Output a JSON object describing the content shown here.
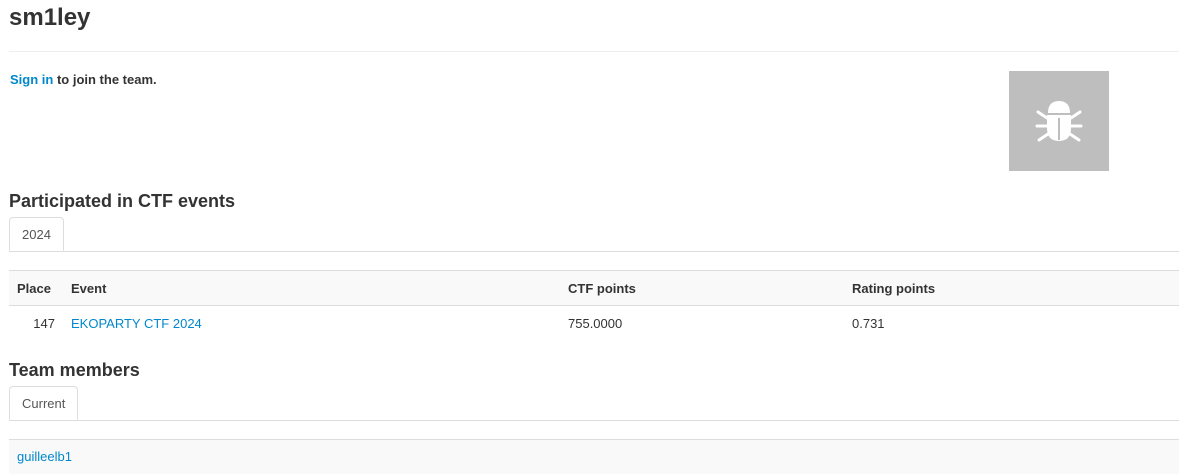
{
  "team": {
    "name": "sm1ley",
    "avatar_icon": "bug-icon"
  },
  "join": {
    "signin_label": "Sign in",
    "suffix": " to join the team."
  },
  "events_section": {
    "title": "Participated in CTF events",
    "tabs": [
      {
        "label": "2024",
        "active": true
      }
    ],
    "columns": {
      "place": "Place",
      "event": "Event",
      "ctf_points": "CTF points",
      "rating_points": "Rating points"
    },
    "rows": [
      {
        "place": "147",
        "event": "EKOPARTY CTF 2024",
        "ctf_points": "755.0000",
        "rating_points": "0.731"
      }
    ]
  },
  "members_section": {
    "title": "Team members",
    "tabs": [
      {
        "label": "Current",
        "active": true
      }
    ],
    "members": [
      "guilleelb1"
    ]
  },
  "colors": {
    "link": "#0088cc",
    "avatar_bg": "#bdbebd",
    "header_bg": "#f9f9f9",
    "border": "#dddddd"
  }
}
